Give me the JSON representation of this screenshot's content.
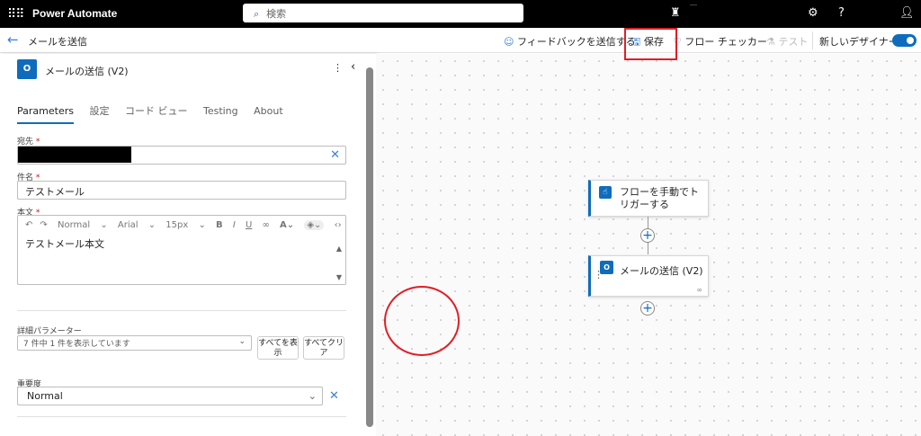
{
  "header": {
    "app_title": "Power Automate",
    "search_placeholder": "検索",
    "badge_text": "‥‥"
  },
  "commandbar": {
    "back_title": "メールを送信",
    "feedback": "フィードバックを送信する",
    "save": "保存",
    "flow_checker": "フロー チェッカー",
    "test": "テスト",
    "new_designer": "新しいデザイナー",
    "new_designer_on": true
  },
  "panel": {
    "title": "メールの送信 (V2)",
    "tabs": [
      "Parameters",
      "設定",
      "コード ビュー",
      "Testing",
      "About"
    ],
    "to_label": "宛先",
    "subject_label": "件名",
    "subject_value": "テストメール",
    "body_label": "本文",
    "rte": {
      "format": "Normal",
      "font": "Arial",
      "size": "15px",
      "body_text": "テストメール本文"
    },
    "advanced_label": "詳細パラメーター",
    "advanced_value": "7 件中 1 件を表示しています",
    "show_all": "すべてを表示",
    "clear_all": "すべてクリア",
    "importance_label": "重要度",
    "importance_value": "Normal"
  },
  "canvas": {
    "trigger_node": "フローを手動でトリガーする",
    "action_node": "メールの送信 (V2)"
  }
}
